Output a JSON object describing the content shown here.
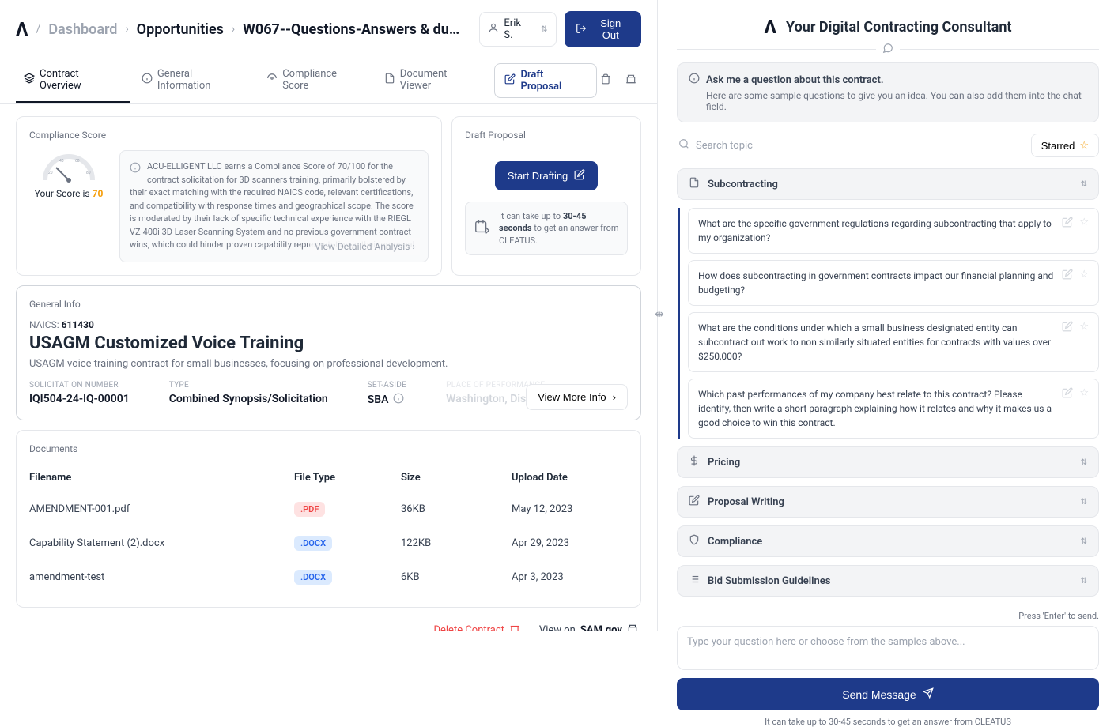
{
  "header": {
    "dashboard": "Dashboard",
    "opportunities": "Opportunities",
    "title": "W067--Questions-Answers & due…",
    "user": "Erik S.",
    "signout": "Sign Out"
  },
  "tabs": {
    "overview": "Contract Overview",
    "general": "General Information",
    "compliance": "Compliance Score",
    "docviewer": "Document Viewer",
    "draft": "Draft Proposal"
  },
  "compliance": {
    "card_title": "Compliance Score",
    "score_prefix": "Your Score is ",
    "score": "70",
    "desc": "ACU-ELLIGENT LLC earns a Compliance Score of 70/100 for the contract solicitation for 3D scanners training, primarily bolstered by their exact matching with the required NAICS code, relevant certifications, and compatibility with response times and geographical scope. The score is moderated by their lack of specific technical experience with the RIEGL VZ-400i 3D Laser Scanning System and no previous government contract wins, which could hinder proven capability representation in their proposal.",
    "view_analysis": "View Detailed Analysis"
  },
  "draft": {
    "card_title": "Draft Proposal",
    "start": "Start Drafting",
    "wait_prefix": "It can take up to ",
    "wait_bold": "30-45 seconds",
    "wait_suffix": " to get an answer from CLEATUS."
  },
  "general": {
    "card_title": "General Info",
    "naics_label": "NAICS: ",
    "naics": "611430",
    "title": "USAGM Customized Voice Training",
    "desc": "USAGM voice training contract for small businesses, focusing on professional development.",
    "sol_label": "SOLICITATION NUMBER",
    "sol": "IQI504-24-IQ-00001",
    "type_label": "TYPE",
    "type": "Combined Synopsis/Solicitation",
    "setaside_label": "SET-ASIDE",
    "setaside": "SBA",
    "place_label": "PLACE OF PERFORMANCE",
    "place": "Washington, Distric",
    "view_more": "View More Info"
  },
  "documents": {
    "card_title": "Documents",
    "cols": {
      "filename": "Filename",
      "filetype": "File Type",
      "size": "Size",
      "upload": "Upload Date"
    },
    "rows": [
      {
        "name": "AMENDMENT-001.pdf",
        "type": ".PDF",
        "type_cls": "pdf",
        "size": "36KB",
        "date": "May 12, 2023"
      },
      {
        "name": "Capability Statement (2).docx",
        "type": ".DOCX",
        "type_cls": "docx",
        "size": "122KB",
        "date": "Apr 29, 2023"
      },
      {
        "name": "amendment-test",
        "type": ".DOCX",
        "type_cls": "docx",
        "size": "6KB",
        "date": "Apr 3, 2023"
      }
    ]
  },
  "footer": {
    "delete": "Delete Contract",
    "view_on": "View on ",
    "sam": "SAM.gov"
  },
  "right": {
    "title": "Your Digital Contracting Consultant",
    "ask_title": "Ask me a question about this contract.",
    "ask_sub": "Here are some sample questions to give you an idea. You can also add them into the chat field.",
    "search_placeholder": "Search topic",
    "starred": "Starred",
    "sections": {
      "subcontracting": "Subcontracting",
      "pricing": "Pricing",
      "proposal": "Proposal Writing",
      "compliance": "Compliance",
      "bid": "Bid Submission Guidelines"
    },
    "questions": [
      "What are the specific government regulations regarding subcontracting that apply to my organization?",
      "How does subcontracting in government contracts impact our financial planning and budgeting?",
      "What are the conditions under which a small business designated entity can subcontract out work to non similarly situated entities for contracts with values over $250,000?",
      "Which past performances of my company best relate to this contract? Please identify, then write a short paragraph explaining how it relates and why it makes us a good choice to win this contract."
    ],
    "enter_hint": "Press 'Enter' to send.",
    "msg_placeholder": "Type your question here or choose from the samples above...",
    "send": "Send Message",
    "wait_hint": "It can take up to 30-45 seconds to get an answer from CLEATUS"
  }
}
